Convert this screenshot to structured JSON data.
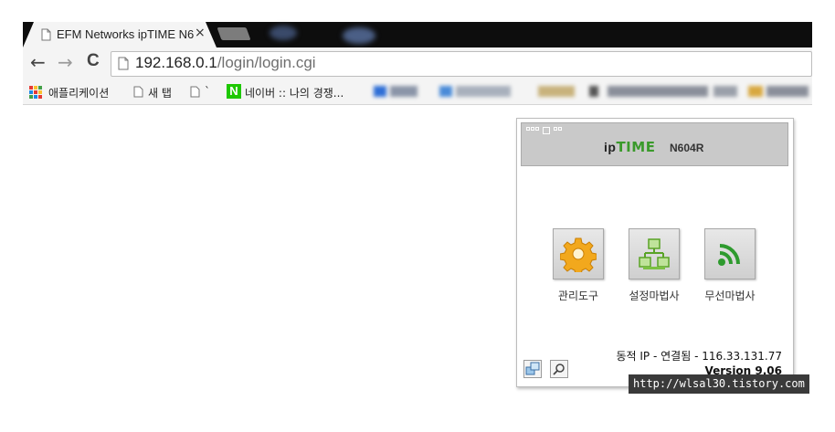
{
  "browser": {
    "tab": {
      "title": "EFM Networks ipTIME N6",
      "close": "×"
    },
    "nav": {
      "back": "←",
      "forward": "→",
      "reload": "C"
    },
    "address": {
      "host": "192.168.0.1",
      "path": "/login/login.cgi"
    },
    "bookmarks": [
      {
        "label": "애플리케이션"
      },
      {
        "label": "새 탭"
      },
      {
        "label": "`"
      },
      {
        "label": "네이버 :: 나의 경쟁..."
      }
    ],
    "naver_icon_letter": "N"
  },
  "router": {
    "brand_ip": "ip",
    "brand_time": "TIME",
    "model": "N604R",
    "tools": [
      {
        "label": "관리도구",
        "icon": "gear-icon"
      },
      {
        "label": "설정마법사",
        "icon": "network-icon"
      },
      {
        "label": "무선마법사",
        "icon": "wireless-icon"
      }
    ],
    "status_label": "동적 IP - 연결됨",
    "ip_address": "116.33.131.77",
    "status": "동적 IP - 연결됨 - 116.33.131.77",
    "version": "Version 9.06"
  },
  "watermark": "http://wlsal30.tistory.com",
  "colors": {
    "gear": "#f2a81d",
    "network": "#7bc043",
    "wireless": "#2e9a2e",
    "header": "#c9c9c9"
  }
}
